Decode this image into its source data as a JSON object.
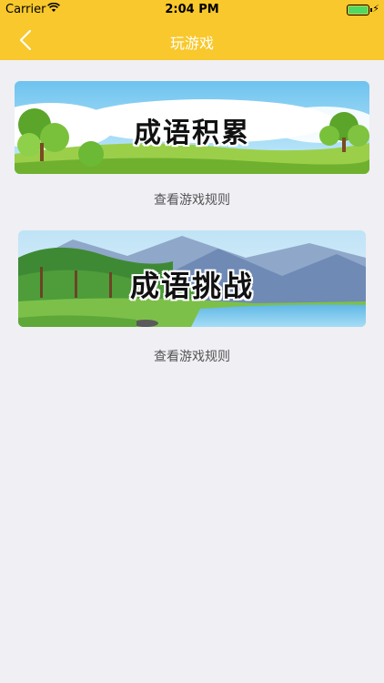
{
  "status_bar": {
    "carrier": "Carrier",
    "time": "2:04 PM",
    "battery_level": 1.0
  },
  "nav": {
    "title": "玩游戏",
    "back_icon": "chevron-left-icon"
  },
  "games": [
    {
      "banner_text": "成语积累",
      "rules_label": "查看游戏规则"
    },
    {
      "banner_text": "成语挑战",
      "rules_label": "查看游戏规则"
    }
  ],
  "colors": {
    "header": "#f8c82c",
    "background": "#efeff4"
  }
}
